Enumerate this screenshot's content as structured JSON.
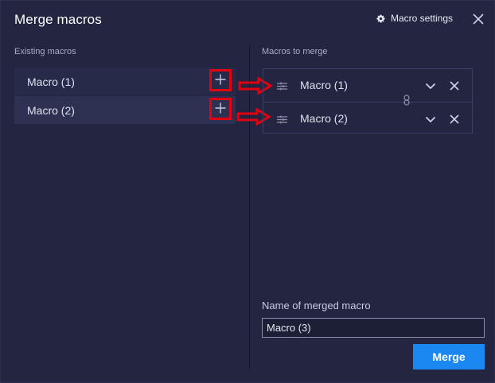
{
  "dialog": {
    "title": "Merge macros",
    "settings_label": "Macro settings"
  },
  "existing": {
    "label": "Existing macros",
    "items": [
      {
        "label": "Macro (1)"
      },
      {
        "label": "Macro (2)"
      }
    ]
  },
  "to_merge": {
    "label": "Macros to merge",
    "items": [
      {
        "label": "Macro (1)"
      },
      {
        "label": "Macro (2)"
      }
    ]
  },
  "merged_name": {
    "label": "Name of merged macro",
    "value": "Macro (3)"
  },
  "merge_button": "Merge",
  "icons": {
    "settings": "gear-icon",
    "close": "close-icon",
    "add": "plus-icon",
    "drag": "drag-handle-icon",
    "expand": "chevron-down-icon",
    "remove": "close-icon",
    "link": "link-icon",
    "annotation": "red-arrow-icon"
  },
  "colors": {
    "background": "#232541",
    "accent": "#1a88f0",
    "highlight": "#e3000f"
  }
}
